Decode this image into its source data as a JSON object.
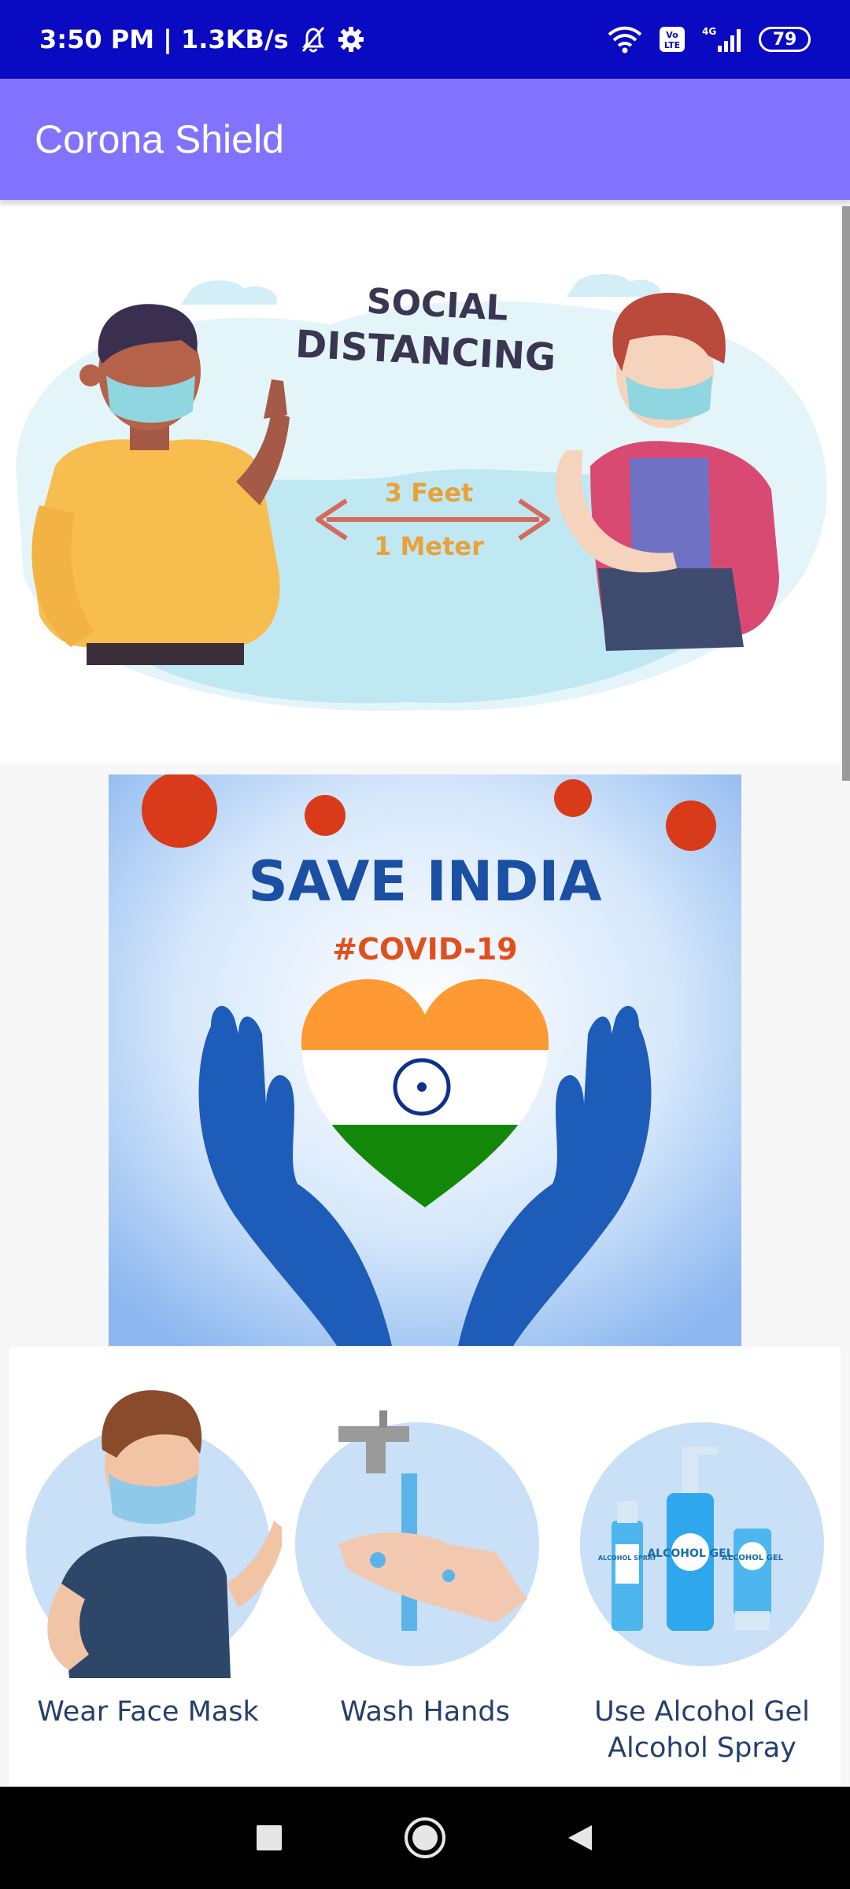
{
  "status_bar": {
    "time_and_speed": "3:50 PM | 1.3KB/s",
    "network_type": "4G",
    "volte": "Vo LTE",
    "battery_level": "79"
  },
  "app_bar": {
    "title": "Corona Shield"
  },
  "social_distancing": {
    "heading_line1": "SOCIAL",
    "heading_line2": "DISTANCING",
    "distance_feet": "3 Feet",
    "distance_meter": "1 Meter"
  },
  "save_india": {
    "heading": "SAVE INDIA",
    "hashtag": "#COVID-19"
  },
  "tips": [
    {
      "label": "Wear Face Mask",
      "icon": "face-mask-person-icon"
    },
    {
      "label": "Wash Hands",
      "icon": "wash-hands-icon"
    },
    {
      "label_line1": "Use Alcohol Gel",
      "label_line2": "Alcohol Spray",
      "icon": "alcohol-gel-icon",
      "bottle_labels": {
        "spray": "ALCOHOL SPRAY",
        "gel": "ALCOHOL GEL",
        "tube": "ALCOHOL GEL"
      }
    }
  ],
  "colors": {
    "status_bar": "#0a0ac2",
    "app_bar": "#8273ff",
    "tip_text": "#25406b",
    "virus": "#d93a1a",
    "save_india_text": "#1a4fa3",
    "saffron": "#ff9933",
    "green": "#138808"
  }
}
